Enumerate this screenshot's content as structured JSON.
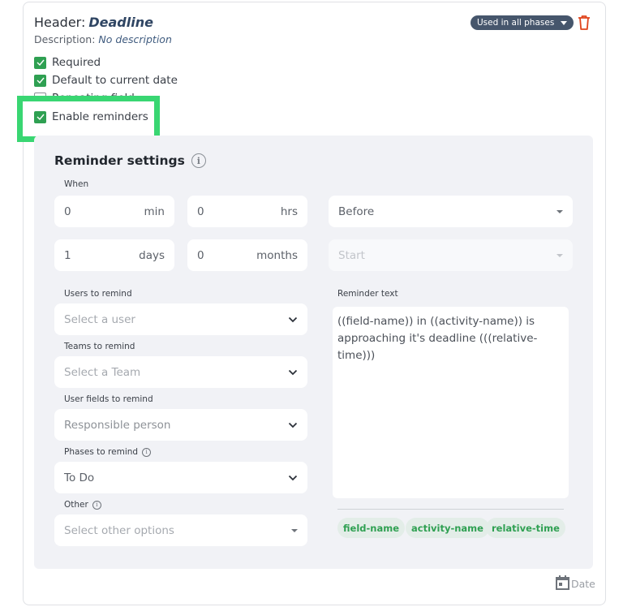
{
  "header": {
    "label": "Header:",
    "title": "Deadline",
    "description_label": "Description:",
    "description_value": "No description",
    "phase_badge": "Used in all phases",
    "delete_icon": "trash-icon"
  },
  "options": [
    {
      "label": "Required",
      "checked": true
    },
    {
      "label": "Default to current date",
      "checked": true
    },
    {
      "label": "Repeating field",
      "checked": false
    },
    {
      "label": "Enable reminders",
      "checked": true
    }
  ],
  "reminder": {
    "title": "Reminder settings",
    "when_label": "When",
    "min": {
      "value": "0",
      "unit": "min"
    },
    "hrs": {
      "value": "0",
      "unit": "hrs"
    },
    "days": {
      "value": "1",
      "unit": "days"
    },
    "months": {
      "value": "0",
      "unit": "months"
    },
    "relation": "Before",
    "anchor_placeholder": "Start",
    "users": {
      "label": "Users to remind",
      "placeholder": "Select a user"
    },
    "teams": {
      "label": "Teams to remind",
      "placeholder": "Select a Team"
    },
    "user_fields": {
      "label": "User fields to remind",
      "value": "Responsible person"
    },
    "phases": {
      "label": "Phases to remind",
      "value": "To Do"
    },
    "other": {
      "label": "Other",
      "placeholder": "Select other options"
    },
    "text_label": "Reminder text",
    "text_value": "((field-name)) in ((activity-name)) is approaching it's deadline (((relative-time)))",
    "tokens": [
      "field-name",
      "activity-name",
      "relative-time"
    ]
  },
  "field_type": {
    "label": "Date",
    "icon": "calendar-icon"
  },
  "colors": {
    "accent": "#2fa052",
    "highlight": "#39d672",
    "badge": "#46566c",
    "danger": "#e0441c"
  }
}
